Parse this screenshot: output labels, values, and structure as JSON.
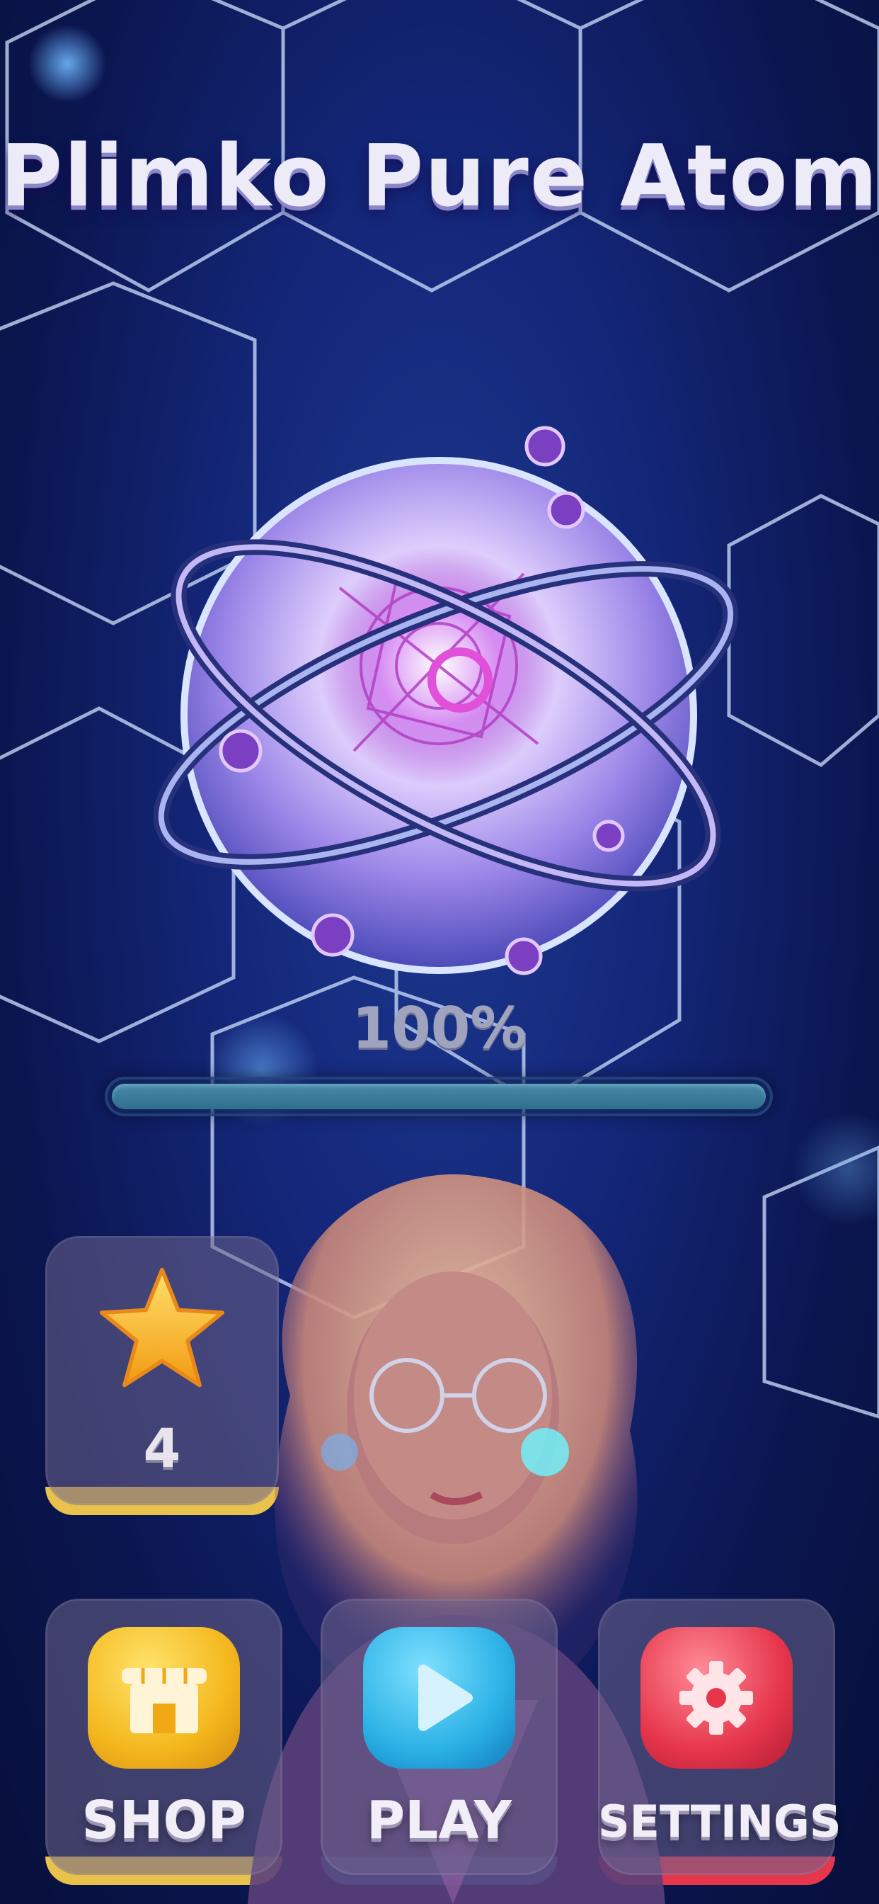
{
  "title": "Plimko Pure Atom",
  "loading": {
    "percent_text": "100%",
    "progress": 1.0
  },
  "stars": {
    "count": "4",
    "icon": "star-icon"
  },
  "buttons": [
    {
      "id": "shop",
      "label": "SHOP",
      "icon": "store-icon",
      "color": "#f4b81e"
    },
    {
      "id": "play",
      "label": "PLAY",
      "icon": "play-icon",
      "color": "#2bb2e6"
    },
    {
      "id": "settings",
      "label": "SETTINGS",
      "icon": "gear-icon",
      "color": "#e6364c"
    }
  ],
  "colors": {
    "accent_yellow": "#f4b81e",
    "accent_blue": "#2bb2e6",
    "accent_red": "#e6364c"
  }
}
